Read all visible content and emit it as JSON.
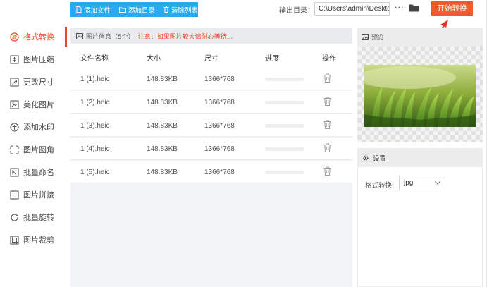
{
  "toolbar": {
    "add_file": "添加文件",
    "add_folder": "添加目录",
    "clear_list": "清除列表"
  },
  "output": {
    "label": "输出目录：",
    "path": "C:\\Users\\admin\\Deskto",
    "more": "···",
    "start_button": "开始转换"
  },
  "sidebar": {
    "items": [
      {
        "label": "格式转换",
        "icon": "format-convert-icon",
        "active": true
      },
      {
        "label": "图片压缩",
        "icon": "compress-icon"
      },
      {
        "label": "更改尺寸",
        "icon": "resize-icon"
      },
      {
        "label": "美化图片",
        "icon": "beautify-icon"
      },
      {
        "label": "添加水印",
        "icon": "watermark-icon"
      },
      {
        "label": "图片圆角",
        "icon": "round-corner-icon"
      },
      {
        "label": "批量命名",
        "icon": "rename-icon"
      },
      {
        "label": "图片拼接",
        "icon": "stitch-icon"
      },
      {
        "label": "批量旋转",
        "icon": "rotate-icon"
      },
      {
        "label": "图片裁剪",
        "icon": "crop-icon"
      }
    ]
  },
  "file_info": {
    "title": "图片信息（5个）",
    "note": "注意：如果图片较大请耐心等待..."
  },
  "table": {
    "headers": {
      "name": "文件名称",
      "size": "大小",
      "dimensions": "尺寸",
      "progress": "进度",
      "action": "操作"
    },
    "rows": [
      {
        "name": "1 (1).heic",
        "size": "148.83KB",
        "dimensions": "1366*768",
        "progress": 0
      },
      {
        "name": "1 (2).heic",
        "size": "148.83KB",
        "dimensions": "1366*768",
        "progress": 0
      },
      {
        "name": "1 (3).heic",
        "size": "148.83KB",
        "dimensions": "1366*768",
        "progress": 0
      },
      {
        "name": "1 (4).heic",
        "size": "148.83KB",
        "dimensions": "1366*768",
        "progress": 0
      },
      {
        "name": "1 (5).heic",
        "size": "148.83KB",
        "dimensions": "1366*768",
        "progress": 0
      }
    ]
  },
  "preview": {
    "title": "预览"
  },
  "settings": {
    "title": "设置",
    "format_label": "格式转换:",
    "format_value": "jpg"
  },
  "colors": {
    "accent": "#e8462a",
    "start_button": "#f05a28",
    "toolbar": "#29a9f0"
  }
}
